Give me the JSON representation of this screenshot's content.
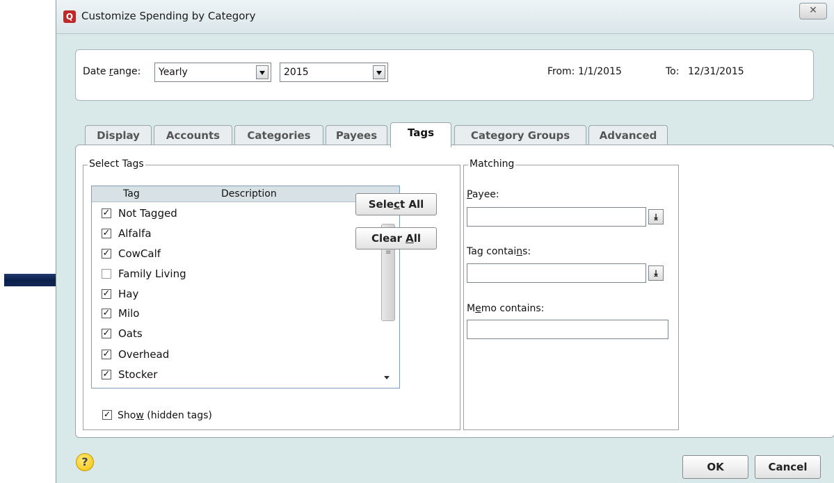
{
  "window": {
    "title": "Customize Spending by Category",
    "close_glyph": "✕"
  },
  "date_range": {
    "label": "Date range:",
    "period": "Yearly",
    "year": "2015",
    "from_label": "From:",
    "from_value": "1/1/2015",
    "to_label": "To:",
    "to_value": "12/31/2015"
  },
  "tabs": [
    {
      "label": "Display",
      "active": false
    },
    {
      "label": "Accounts",
      "active": false
    },
    {
      "label": "Categories",
      "active": false
    },
    {
      "label": "Payees",
      "active": false
    },
    {
      "label": "Tags",
      "active": true
    },
    {
      "label": "Category Groups",
      "active": false
    },
    {
      "label": "Advanced",
      "active": false
    }
  ],
  "select_tags": {
    "group_label": "Select Tags",
    "columns": [
      "Tag",
      "Description"
    ],
    "items": [
      {
        "name": "Not Tagged",
        "checked": true
      },
      {
        "name": "Alfalfa",
        "checked": true
      },
      {
        "name": "CowCalf",
        "checked": true
      },
      {
        "name": "Family Living",
        "checked": false
      },
      {
        "name": "Hay",
        "checked": true
      },
      {
        "name": "Milo",
        "checked": true
      },
      {
        "name": "Oats",
        "checked": true
      },
      {
        "name": "Overhead",
        "checked": true
      },
      {
        "name": "Stocker",
        "checked": true
      }
    ],
    "select_all_label": "Select All",
    "clear_all_label": "Clear All",
    "show_hidden_label": "Show (hidden tags)",
    "show_hidden_checked": true
  },
  "matching": {
    "group_label": "Matching",
    "payee_label": "Payee:",
    "tag_contains_label": "Tag contains:",
    "memo_contains_label": "Memo contains:"
  },
  "footer": {
    "help_glyph": "?",
    "ok_label": "OK",
    "cancel_label": "Cancel"
  },
  "annotation": {
    "arrow_color": "#0b1f4a"
  }
}
